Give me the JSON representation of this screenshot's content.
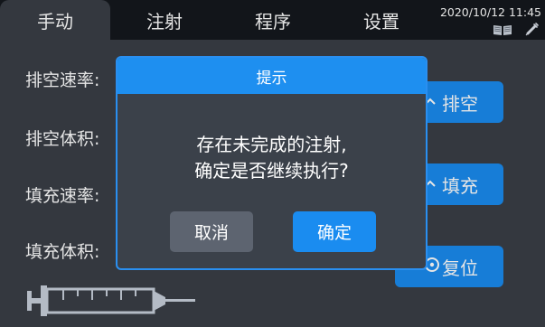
{
  "tabs": [
    {
      "label": "手动",
      "active": true
    },
    {
      "label": "注射",
      "active": false
    },
    {
      "label": "程序",
      "active": false
    },
    {
      "label": "设置",
      "active": false
    }
  ],
  "status": {
    "datetime": "2020/10/12 11:45",
    "icons": [
      "book-icon",
      "syringe-icon"
    ]
  },
  "fields": {
    "purge_rate": "排空速率:",
    "purge_volume": "排空体积:",
    "fill_rate": "填充速率:",
    "fill_volume": "填充体积:"
  },
  "actions": {
    "purge": "排空",
    "fill": "填充",
    "reset": "复位"
  },
  "dialog": {
    "title": "提示",
    "message_line1": "存在未完成的注射,",
    "message_line2": "确定是否继续执行?",
    "cancel": "取消",
    "confirm": "确定"
  },
  "colors": {
    "accent": "#1a8cf0",
    "background": "#3a3f47",
    "tabbar": "#15181d",
    "cancel_button": "#5d6470"
  }
}
